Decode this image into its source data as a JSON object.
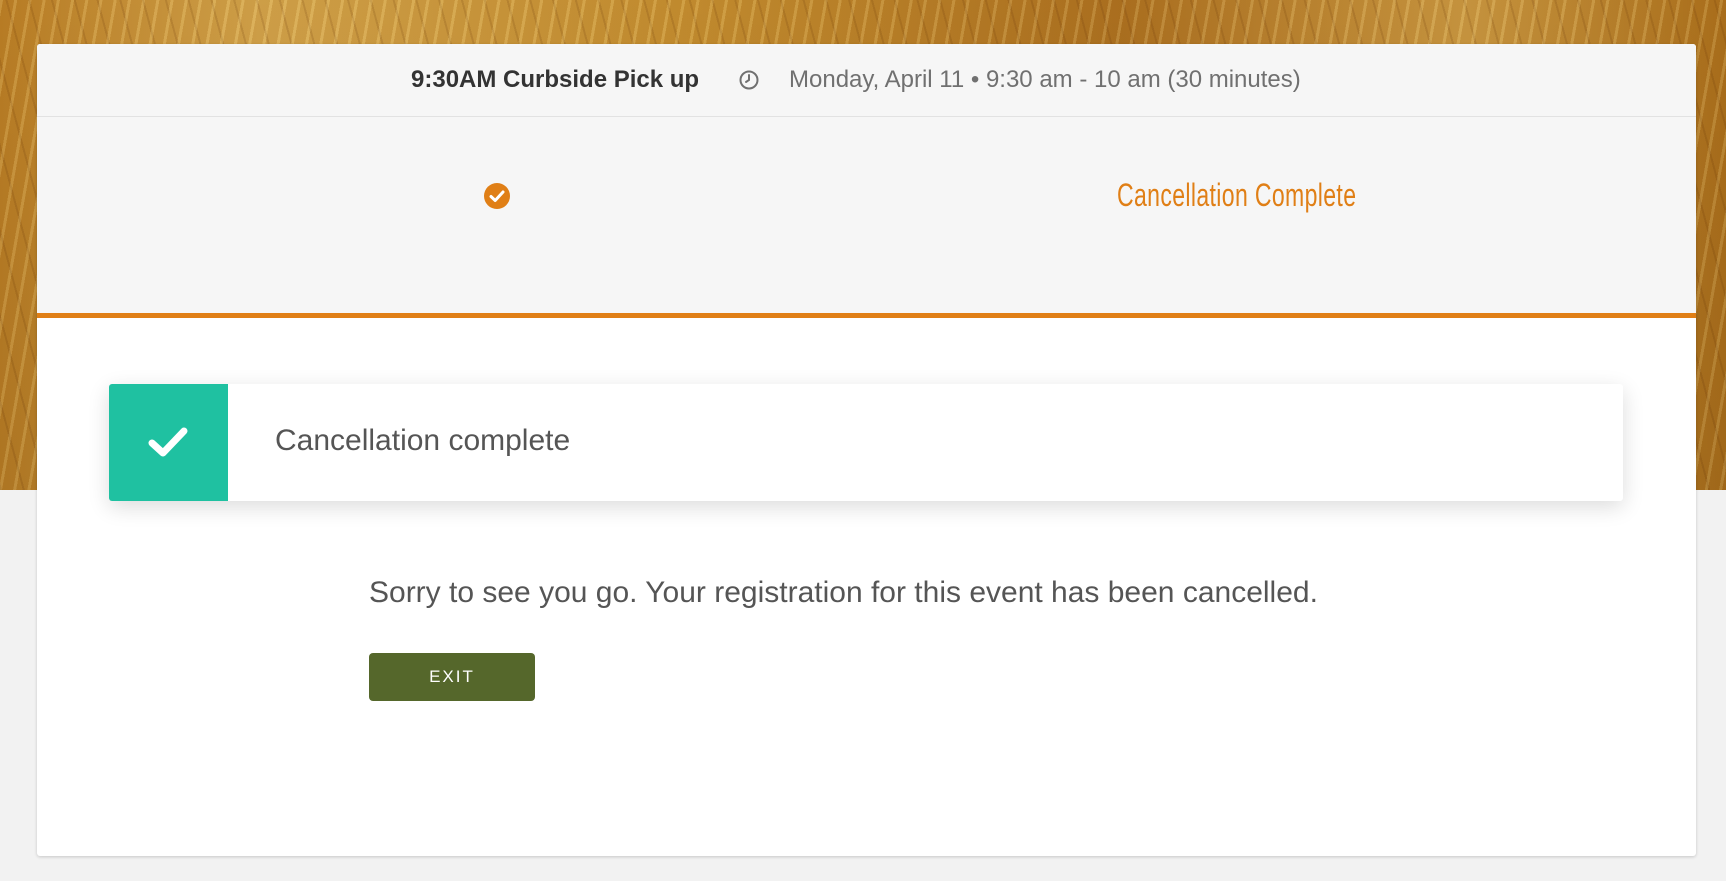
{
  "event": {
    "title": "9:30AM Curbside Pick up",
    "datetime": "Monday, April 11 • 9:30 am - 10 am (30 minutes)"
  },
  "steps": {
    "current_label": "Cancellation Complete"
  },
  "alert": {
    "text": "Cancellation complete"
  },
  "message": {
    "text": "Sorry to see you go. Your registration for this event has been cancelled."
  },
  "exit_button": {
    "label": "EXIT"
  },
  "colors": {
    "accent_orange": "#e07f16",
    "success_teal": "#1fc1a1",
    "button_green": "#55672b"
  }
}
